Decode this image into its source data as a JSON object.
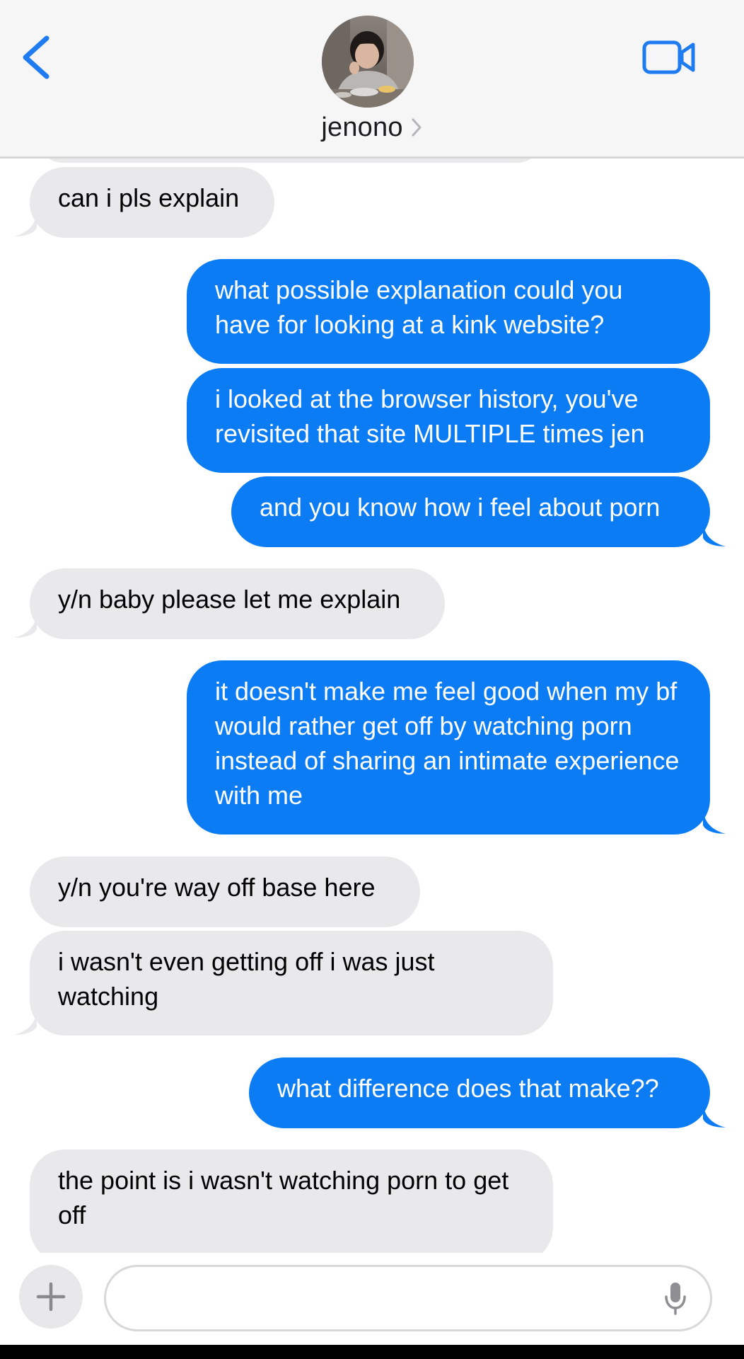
{
  "header": {
    "contact_name": "jenono",
    "back_label": "",
    "video_label": ""
  },
  "messages": [
    {
      "side": "in",
      "text": "can i pls explain"
    },
    {
      "side": "out",
      "text": "what possible explanation could you have for looking at a kink website?"
    },
    {
      "side": "out",
      "text": "i looked at the browser history, you've revisited that site MULTIPLE times jen"
    },
    {
      "side": "out",
      "text": "and you know how i feel about porn"
    },
    {
      "side": "in",
      "text": "y/n baby please let me explain"
    },
    {
      "side": "out",
      "text": "it doesn't make me feel good when my bf would rather get off by watching porn instead of sharing an intimate experience with me"
    },
    {
      "side": "in",
      "text": "y/n you're way off base here"
    },
    {
      "side": "in",
      "text": "i wasn't even getting off i was just watching"
    },
    {
      "side": "out",
      "text": "what difference does that make??"
    },
    {
      "side": "in",
      "text": "the point is i wasn't watching porn to get off"
    }
  ],
  "composer": {
    "input_value": "",
    "input_placeholder": ""
  },
  "colors": {
    "accent": "#0b7cf3",
    "incoming_bubble": "#e9e9eb",
    "header_bg": "#f6f6f6",
    "icon_blue": "#1f7cf0"
  },
  "icons": {
    "back": "chevron-left-icon",
    "video": "video-camera-icon",
    "chevron": "chevron-right-icon",
    "plus": "plus-icon",
    "mic": "microphone-icon"
  }
}
